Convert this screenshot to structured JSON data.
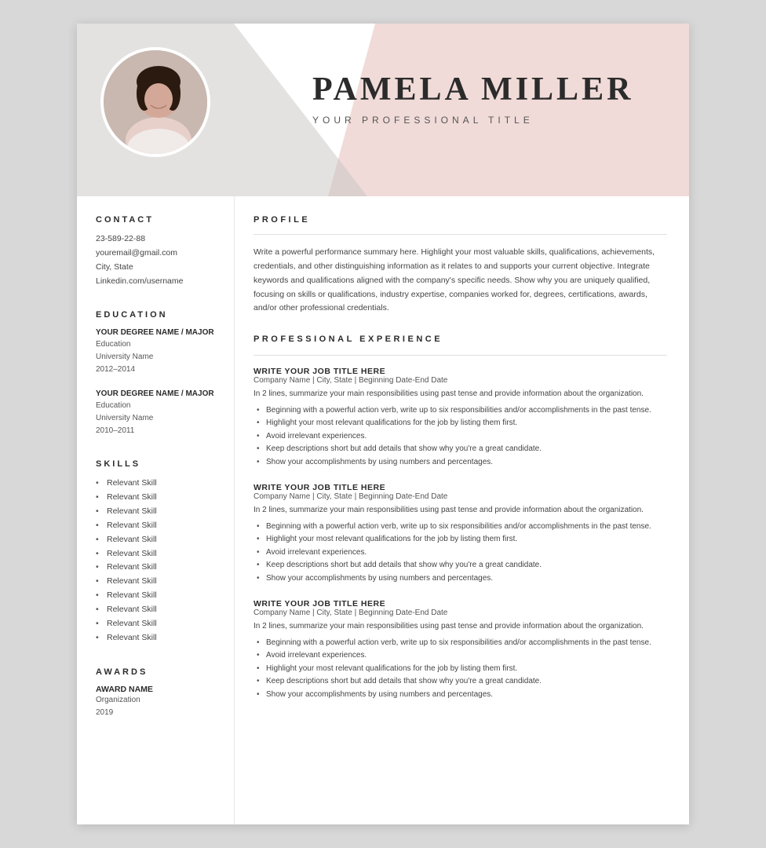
{
  "header": {
    "name": "PAMELA MILLER",
    "title": "YOUR PROFESSIONAL TITLE"
  },
  "sidebar": {
    "contact_heading": "CONTACT",
    "contact": {
      "phone": "23-589-22-88",
      "email": "youremail@gmail.com",
      "location": "City, State",
      "linkedin": "Linkedin.com/username"
    },
    "education_heading": "EDUCATION",
    "education": [
      {
        "degree": "YOUR DEGREE NAME / MAJOR",
        "field": "Education",
        "school": "University Name",
        "years": "2012–2014"
      },
      {
        "degree": "YOUR DEGREE NAME / MAJOR",
        "field": "Education",
        "school": "University Name",
        "years": "2010–2011"
      }
    ],
    "skills_heading": "SKILLS",
    "skills": [
      "Relevant Skill",
      "Relevant Skill",
      "Relevant Skill",
      "Relevant Skill",
      "Relevant Skill",
      "Relevant Skill",
      "Relevant Skill",
      "Relevant Skill",
      "Relevant Skill",
      "Relevant Skill",
      "Relevant Skill",
      "Relevant Skill"
    ],
    "awards_heading": "AWARDS",
    "awards": [
      {
        "name": "AWARD NAME",
        "org": "Organization",
        "year": "2019"
      }
    ]
  },
  "main": {
    "profile_heading": "PROFILE",
    "profile_text": "Write a powerful performance summary here. Highlight your most valuable skills, qualifications, achievements, credentials, and other distinguishing information as it relates to and supports your current objective. Integrate keywords and qualifications aligned with the company's specific needs. Show why you are uniquely qualified, focusing on skills or qualifications, industry expertise, companies worked for, degrees, certifications, awards, and/or other professional credentials.",
    "experience_heading": "PROFESSIONAL EXPERIENCE",
    "jobs": [
      {
        "title": "WRITE YOUR JOB TITLE HERE",
        "company": "Company Name | City, State | Beginning Date-End Date",
        "desc": "In 2 lines, summarize your main responsibilities using past tense and provide information about the organization.",
        "bullets": [
          "Beginning with a powerful action verb, write up to six responsibilities and/or accomplishments in the past tense.",
          "Highlight your most relevant qualifications for the job by listing them first.",
          "Avoid irrelevant experiences.",
          "Keep descriptions short but add details that show why you're a great candidate.",
          "Show your accomplishments by using numbers and percentages."
        ]
      },
      {
        "title": "WRITE YOUR JOB TITLE HERE",
        "company": "Company Name | City, State | Beginning Date-End Date",
        "desc": "In 2 lines, summarize your main responsibilities using past tense and provide information about the organization.",
        "bullets": [
          "Beginning with a powerful action verb, write up to six responsibilities and/or accomplishments in the past tense.",
          "Highlight your most relevant qualifications for the job by listing them first.",
          "Avoid irrelevant experiences.",
          "Keep descriptions short but add details that show why you're a great candidate.",
          "Show your accomplishments by using numbers and percentages."
        ]
      },
      {
        "title": "WRITE YOUR JOB TITLE HERE",
        "company": "Company Name | City, State | Beginning Date-End Date",
        "desc": "In 2 lines, summarize your main responsibilities using past tense and provide information about the organization.",
        "bullets": [
          "Beginning with a powerful action verb, write up to six responsibilities and/or accomplishments in the past tense.",
          "Avoid irrelevant experiences.",
          "Highlight your most relevant qualifications for the job by listing them first.",
          "Keep descriptions short but add details that show why you're a great candidate.",
          "Show your accomplishments by using numbers and percentages."
        ]
      }
    ]
  }
}
